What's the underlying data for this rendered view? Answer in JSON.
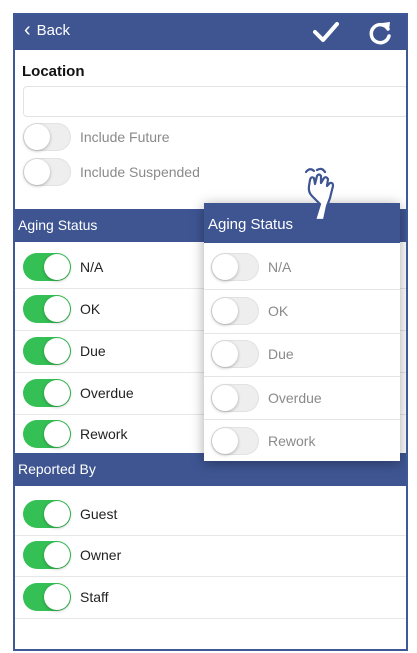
{
  "header": {
    "back_label": "Back"
  },
  "location": {
    "label": "Location",
    "value": "",
    "placeholder": ""
  },
  "options": [
    {
      "label": "Include Future",
      "on": false
    },
    {
      "label": "Include Suspended",
      "on": false
    }
  ],
  "aging": {
    "title": "Aging Status",
    "items": [
      {
        "label": "N/A",
        "on": true
      },
      {
        "label": "OK",
        "on": true
      },
      {
        "label": "Due",
        "on": true
      },
      {
        "label": "Overdue",
        "on": true
      },
      {
        "label": "Rework",
        "on": true
      }
    ]
  },
  "reported": {
    "title": "Reported By",
    "items": [
      {
        "label": "Guest",
        "on": true
      },
      {
        "label": "Owner",
        "on": true
      },
      {
        "label": "Staff",
        "on": true
      }
    ]
  },
  "popup": {
    "title": "Aging Status",
    "items": [
      {
        "label": "N/A",
        "on": false
      },
      {
        "label": "OK",
        "on": false
      },
      {
        "label": "Due",
        "on": false
      },
      {
        "label": "Overdue",
        "on": false
      },
      {
        "label": "Rework",
        "on": false
      }
    ]
  },
  "colors": {
    "header_blue": "#3e5592",
    "toggle_on": "#34c054",
    "toggle_off": "#eeeeee"
  },
  "icons": {
    "back": "chevron-left-icon",
    "save": "checkmark-icon",
    "refresh": "refresh-icon",
    "gesture": "hand-swipe-icon"
  }
}
